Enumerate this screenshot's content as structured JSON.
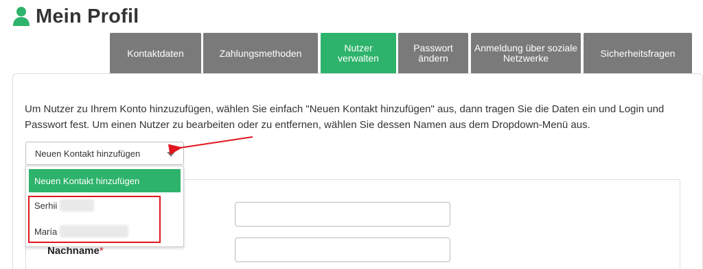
{
  "header": {
    "title": "Mein Profil",
    "icon": "user-icon",
    "icon_color": "#2db36b"
  },
  "tabs": [
    {
      "label": "Kontaktdaten",
      "active": false
    },
    {
      "label": "Zahlungsmethoden",
      "active": false
    },
    {
      "label": "Nutzer verwalten",
      "active": true
    },
    {
      "label": "Passwort ändern",
      "active": false
    },
    {
      "label": "Anmeldung über soziale Netzwerke",
      "active": false
    },
    {
      "label": "Sicherheitsfragen",
      "active": false
    }
  ],
  "intro_text": "Um Nutzer zu Ihrem Konto hinzuzufügen, wählen Sie einfach \"Neuen Kontakt hinzufügen\" aus, dann tragen Sie die Daten ein und Login und Passwort fest. Um einen Nutzer zu bearbeiten oder zu entfernen, wählen Sie dessen Namen aus dem Dropdown-Menü aus.",
  "contact_select": {
    "selected": "Neuen Kontakt hinzufügen",
    "options": [
      {
        "label": "Neuen Kontakt hinzufügen",
        "selected": true
      },
      {
        "label": "Serhii",
        "selected": false
      },
      {
        "label": "María",
        "selected": false
      }
    ]
  },
  "form": {
    "lastname_label": "Nachname",
    "required_marker": "*"
  },
  "colors": {
    "accent": "#2db36b",
    "tab_inactive": "#7a7a7a",
    "annotation": "#e0161e"
  }
}
